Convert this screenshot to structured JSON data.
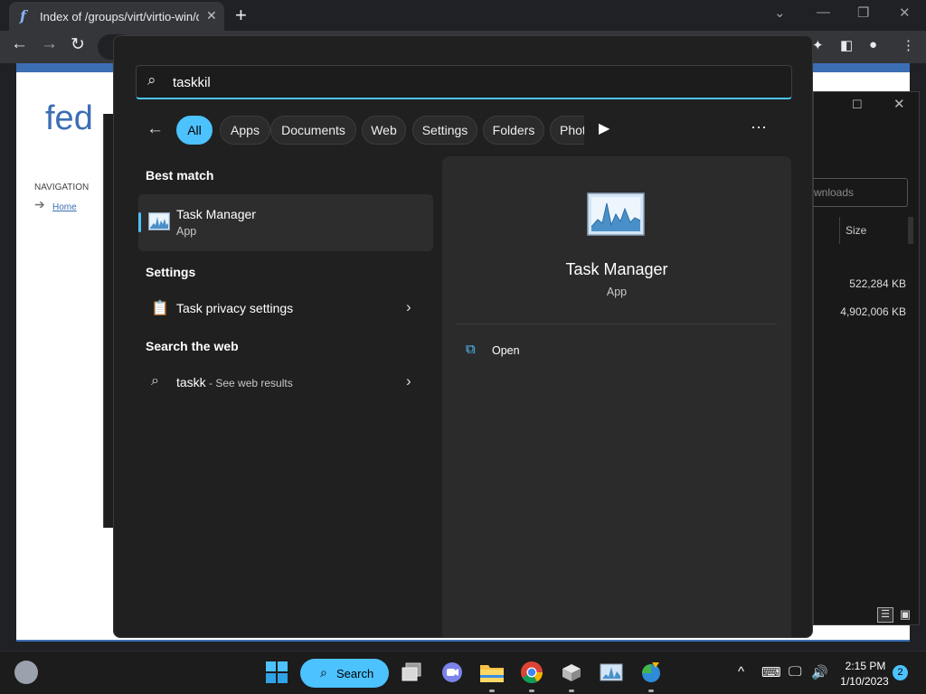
{
  "browser": {
    "tab": {
      "title": "Index of /groups/virt/virtio-win/d",
      "favicon": "f",
      "close": "✕"
    },
    "new_tab": "+",
    "window_controls": {
      "minimize_dropdown": "⌄",
      "minimize": "—",
      "restore": "❐",
      "close": "✕"
    },
    "nav": {
      "back": "←",
      "forward": "→",
      "reload": "↻"
    },
    "toolbar_icons": {
      "extensions": "✦",
      "sidebar": "◧",
      "profile": "●",
      "menu": "⋮"
    }
  },
  "webpage": {
    "logo": "fed",
    "navigation_heading": "NAVIGATION",
    "nav_arrow": "➔",
    "home_link": "Home"
  },
  "explorer": {
    "maximize": "☐",
    "close": "✕",
    "search_placeholder": "wnloads",
    "column_size": "Size",
    "sizes": [
      "522,284 KB",
      "4,902,006 KB"
    ],
    "view_details": "☰",
    "view_tiles": "▣"
  },
  "search": {
    "query": "taskkil",
    "back": "←",
    "filters": [
      "All",
      "Apps",
      "Documents",
      "Web",
      "Settings",
      "Folders",
      "Phot"
    ],
    "active_filter": "All",
    "filters_more": "▶",
    "more_options": "···",
    "best_match": {
      "heading": "Best match",
      "name": "Task Manager",
      "type": "App"
    },
    "settings": {
      "heading": "Settings",
      "item": "Task privacy settings",
      "chevron": "›"
    },
    "web": {
      "heading": "Search the web",
      "query": "taskk",
      "suffix": " - See web results",
      "chevron": "›"
    },
    "preview": {
      "title": "Task Manager",
      "type": "App",
      "action_open": "Open"
    }
  },
  "taskbar": {
    "search_label": "Search",
    "clock_time": "2:15 PM",
    "clock_date": "1/10/2023",
    "notification_count": "2",
    "tray": {
      "chevron": "^",
      "keyboard": "⌨",
      "network": "🖵",
      "volume": "🔊"
    }
  },
  "colors": {
    "accent": "#4cc2ff",
    "panel_bg": "#202020",
    "fedora_blue": "#3c6eb4"
  }
}
